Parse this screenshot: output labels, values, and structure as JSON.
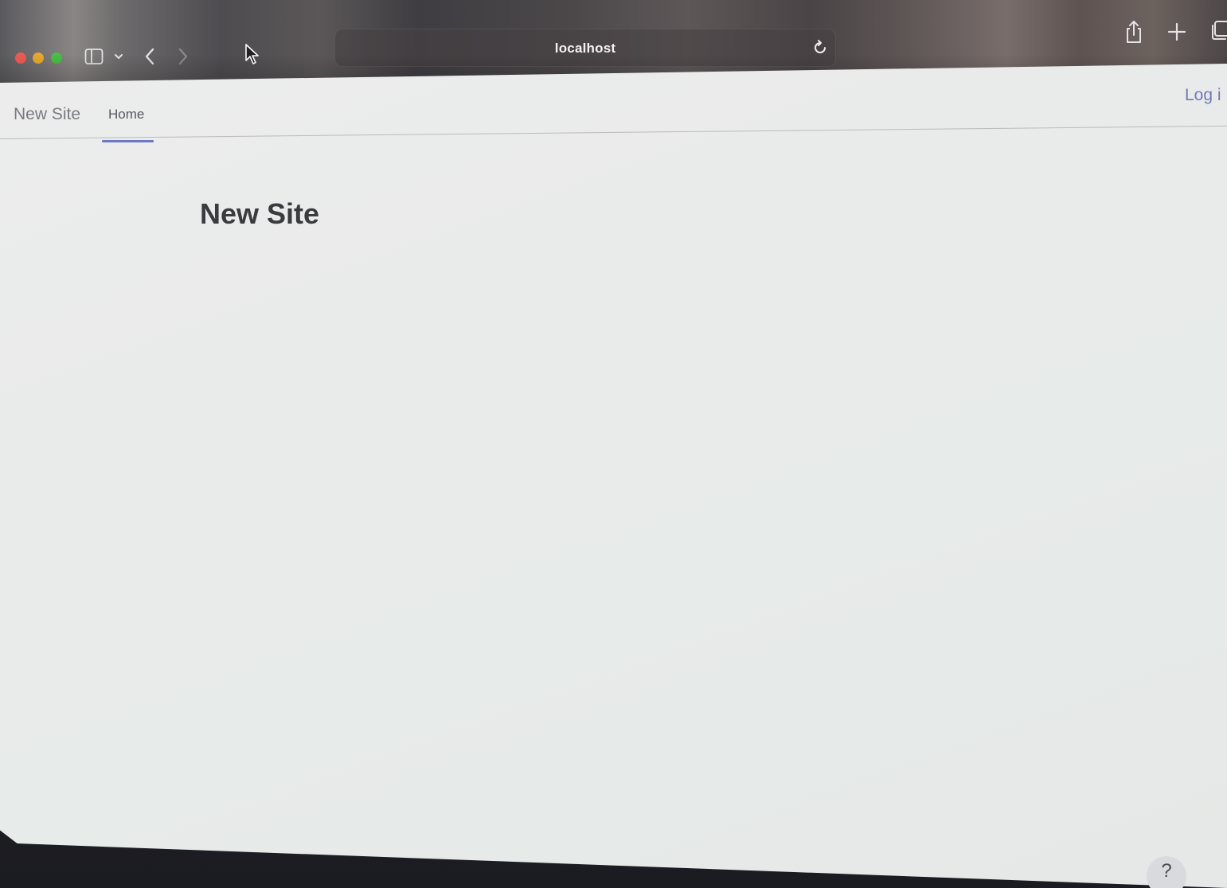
{
  "browser": {
    "address": "localhost",
    "icons": {
      "sidebar": "sidebar-icon",
      "sidebar_menu": "chevron-down-icon",
      "back": "chevron-left-icon",
      "forward": "chevron-right-icon",
      "reload": "reload-icon",
      "share": "share-icon",
      "new_tab": "plus-icon",
      "tab_overview": "tab-overview-icon"
    },
    "window_controls": {
      "close_color": "#ee5b55",
      "minimize_color": "#e6a92f",
      "zoom_color": "#47c045"
    }
  },
  "site": {
    "name": "New Site",
    "nav": {
      "tabs": [
        {
          "label": "Home",
          "active": true
        }
      ],
      "login_label": "Log i",
      "accent_color": "#6f79c1"
    },
    "main": {
      "heading": "New Site"
    },
    "help_label": "?"
  }
}
